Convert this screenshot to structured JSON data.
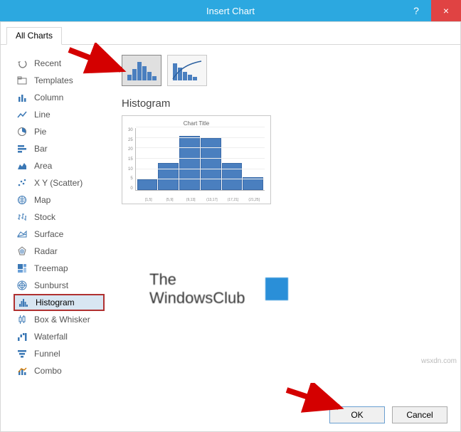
{
  "window": {
    "title": "Insert Chart",
    "help": "?",
    "close": "×"
  },
  "tabs": {
    "all_charts": "All Charts"
  },
  "sidebar": {
    "items": [
      {
        "label": "Recent",
        "icon": "undo-icon"
      },
      {
        "label": "Templates",
        "icon": "folder-icon"
      },
      {
        "label": "Column",
        "icon": "column-icon"
      },
      {
        "label": "Line",
        "icon": "line-icon"
      },
      {
        "label": "Pie",
        "icon": "pie-icon"
      },
      {
        "label": "Bar",
        "icon": "bar-icon"
      },
      {
        "label": "Area",
        "icon": "area-icon"
      },
      {
        "label": "X Y (Scatter)",
        "icon": "scatter-icon"
      },
      {
        "label": "Map",
        "icon": "map-icon"
      },
      {
        "label": "Stock",
        "icon": "stock-icon"
      },
      {
        "label": "Surface",
        "icon": "surface-icon"
      },
      {
        "label": "Radar",
        "icon": "radar-icon"
      },
      {
        "label": "Treemap",
        "icon": "treemap-icon"
      },
      {
        "label": "Sunburst",
        "icon": "sunburst-icon"
      },
      {
        "label": "Histogram",
        "icon": "histogram-icon",
        "selected": true
      },
      {
        "label": "Box & Whisker",
        "icon": "box-icon"
      },
      {
        "label": "Waterfall",
        "icon": "waterfall-icon"
      },
      {
        "label": "Funnel",
        "icon": "funnel-icon"
      },
      {
        "label": "Combo",
        "icon": "combo-icon"
      }
    ]
  },
  "main": {
    "chart_type_name": "Histogram",
    "preview_title": "Chart Title"
  },
  "chart_data": {
    "type": "bar",
    "categories": [
      "[1,5]",
      "(5,9]",
      "(9,13]",
      "(13,17]",
      "(17,21]",
      "(21,25]"
    ],
    "values": [
      5,
      13,
      26,
      25,
      13,
      6
    ],
    "title": "Chart Title",
    "ylabel": "",
    "xlabel": "",
    "ylim": [
      0,
      30
    ],
    "yticks": [
      0,
      5,
      10,
      15,
      20,
      25,
      30
    ]
  },
  "footer": {
    "ok": "OK",
    "cancel": "Cancel"
  },
  "watermark": {
    "line1": "The",
    "line2": "WindowsClub"
  },
  "attribution": "wsxdn.com"
}
